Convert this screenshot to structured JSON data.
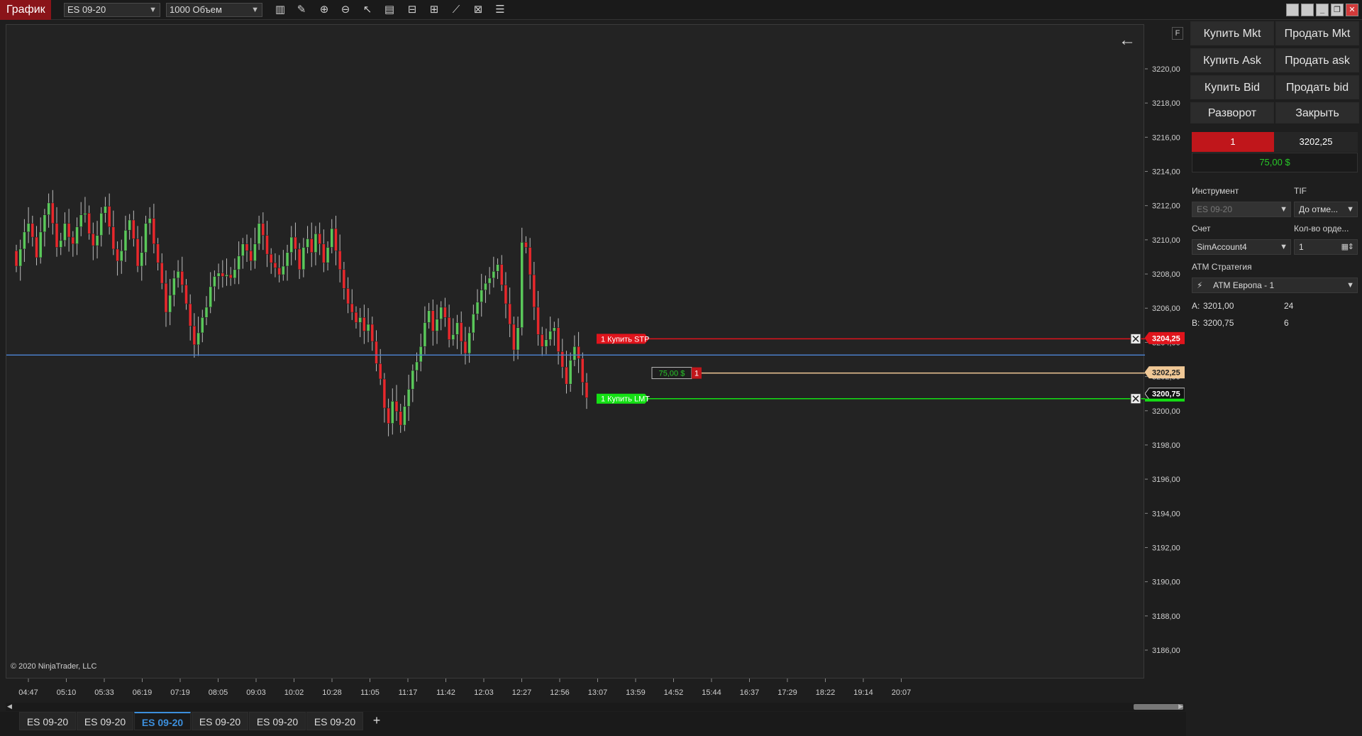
{
  "toolbar": {
    "title": "График",
    "instrument": "ES 09-20",
    "bar_type": "1000 Объем",
    "icons": [
      "bar-type-icon",
      "drawing-tool-icon",
      "zoom-in-icon",
      "zoom-out-icon",
      "pointer-icon",
      "data-box-icon",
      "chart-trader-icon",
      "properties-icon",
      "strategies-icon",
      "templates-icon",
      "indicators-icon"
    ]
  },
  "chart": {
    "copyright": "© 2020 NinjaTrader, LLC",
    "f_label": "F",
    "price_ticks": [
      "3220,00",
      "3218,00",
      "3216,00",
      "3214,00",
      "3212,00",
      "3210,00",
      "3208,00",
      "3206,00",
      "3204,00",
      "3202,00",
      "3200,00",
      "3198,00",
      "3196,00",
      "3194,00",
      "3192,00",
      "3190,00",
      "3188,00",
      "3186,00"
    ],
    "time_ticks": [
      "04:47",
      "05:10",
      "05:33",
      "06:19",
      "07:19",
      "08:05",
      "09:03",
      "10:02",
      "10:28",
      "11:05",
      "11:17",
      "11:42",
      "12:03",
      "12:27",
      "12:56",
      "13:07",
      "13:59",
      "14:52",
      "15:44",
      "16:37",
      "17:29",
      "18:22",
      "19:14",
      "20:07"
    ],
    "stop_order": {
      "label": "1  Купить STP",
      "price": "3204,25",
      "color": "#e0141c"
    },
    "position": {
      "pnl": "75,00 $",
      "qty": "1",
      "price": "3202,25",
      "color": "#f0c896"
    },
    "limit_order": {
      "label": "1  Купить LMT",
      "price": "3200,75",
      "color": "#14e014"
    }
  },
  "tabs": [
    "ES 09-20",
    "ES 09-20",
    "ES 09-20",
    "ES 09-20",
    "ES 09-20",
    "ES 09-20"
  ],
  "active_tab": 2,
  "panel": {
    "buy_mkt": "Купить Mkt",
    "sell_mkt": "Продать Mkt",
    "buy_ask": "Купить Ask",
    "sell_ask": "Продать ask",
    "buy_bid": "Купить Bid",
    "sell_bid": "Продать bid",
    "reverse": "Разворот",
    "close": "Закрыть",
    "position_qty": "1",
    "position_price": "3202,25",
    "position_pnl": "75,00 $",
    "instrument_label": "Инструмент",
    "instrument_value": "ES 09-20",
    "tif_label": "TIF",
    "tif_value": "До отме...",
    "account_label": "Счет",
    "account_value": "SimAccount4",
    "qty_label": "Кол-во орде...",
    "qty_value": "1",
    "atm_label": "ATM Стратегия",
    "atm_value": "ATM Европа - 1",
    "ask_label": "A:",
    "ask_price": "3201,00",
    "ask_size": "24",
    "bid_label": "B:",
    "bid_price": "3200,75",
    "bid_size": "6"
  }
}
